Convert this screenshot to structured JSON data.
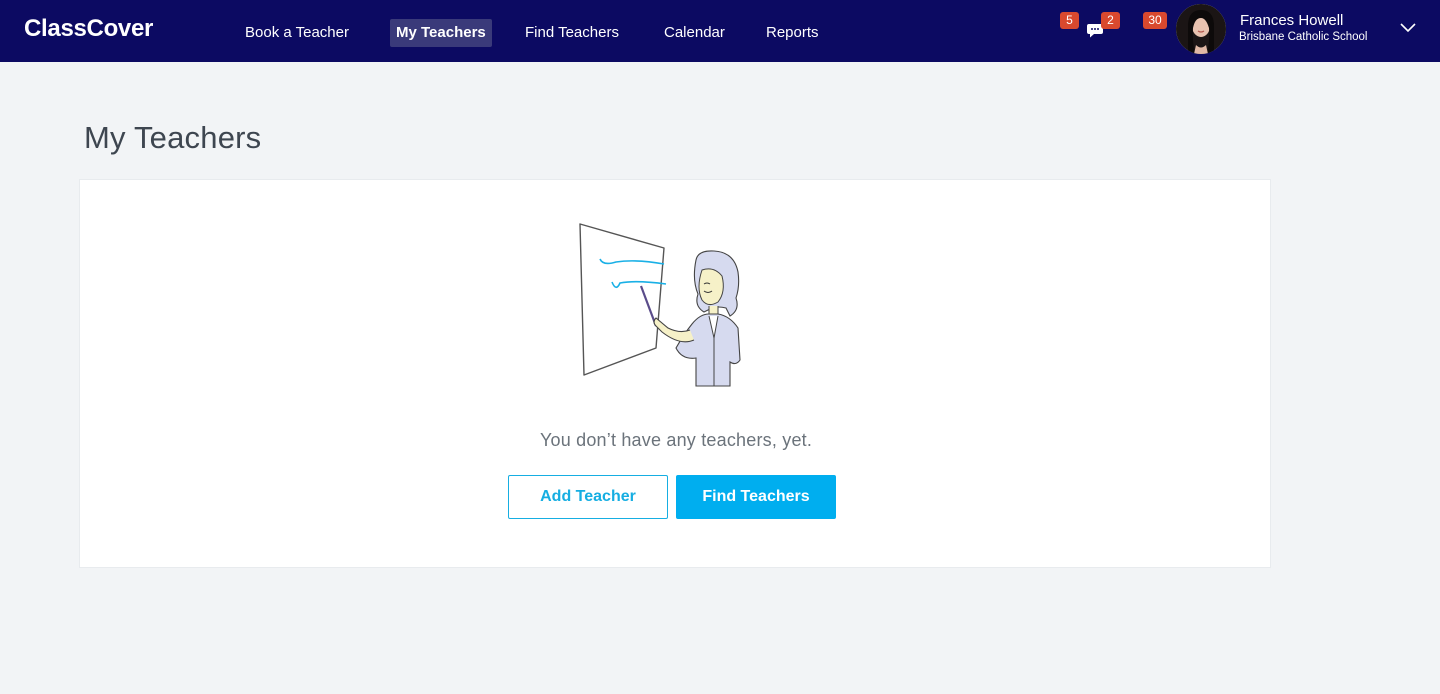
{
  "app": {
    "logo": "ClassCover"
  },
  "nav": {
    "items": [
      {
        "label": "Book a Teacher"
      },
      {
        "label": "My Teachers"
      },
      {
        "label": "Find Teachers"
      },
      {
        "label": "Calendar"
      },
      {
        "label": "Reports"
      }
    ],
    "active": "My Teachers"
  },
  "notifications": {
    "alerts_count": "5",
    "messages_count": "2",
    "requests_count": "30"
  },
  "user": {
    "name": "Frances Howell",
    "school": "Brisbane Catholic School"
  },
  "page": {
    "title": "My Teachers",
    "empty_message": "You don’t have any teachers, yet.",
    "add_teacher_label": "Add Teacher",
    "find_teachers_label": "Find Teachers"
  },
  "colors": {
    "topbar": "#0c0a62",
    "badge": "#d9492e",
    "accent": "#00aeef",
    "page_bg": "#f2f4f6"
  },
  "icons": {
    "chat": "chat-bubbles-icon",
    "user_menu": "chevron-down-icon",
    "illustration": "teacher-whiteboard-illustration"
  }
}
